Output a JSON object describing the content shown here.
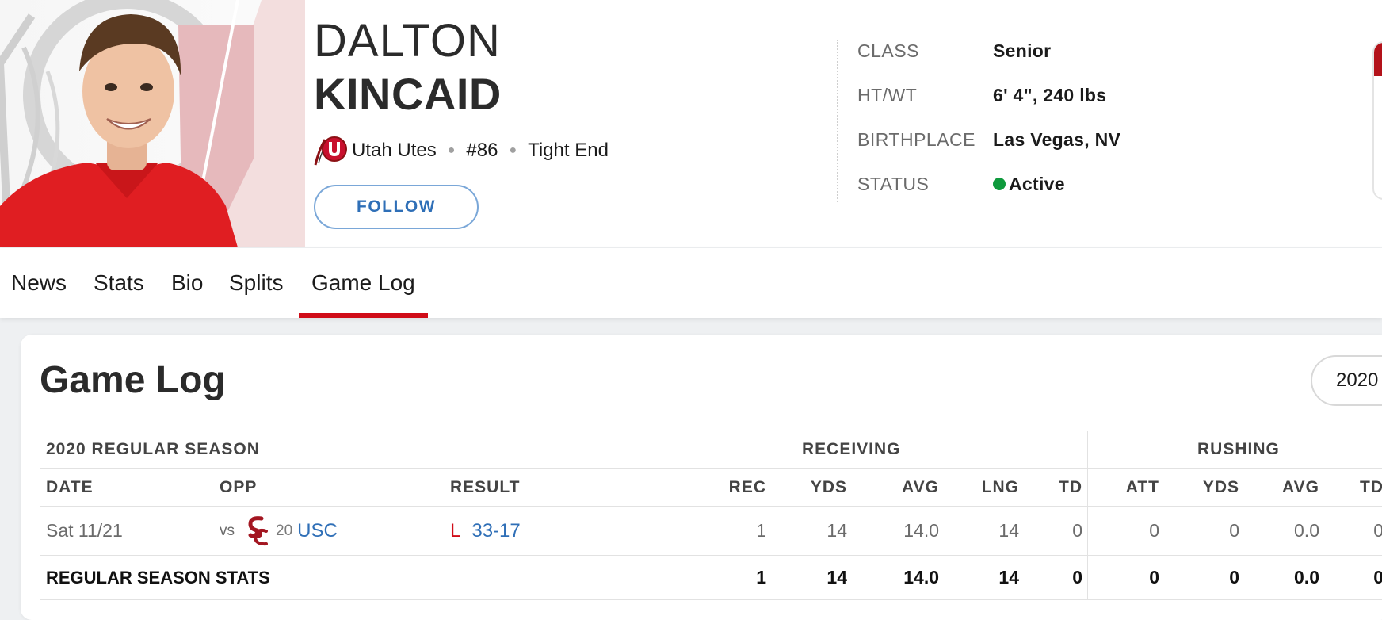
{
  "player": {
    "first_name": "DALTON",
    "last_name": "KINCAID",
    "team": "Utah Utes",
    "number": "#86",
    "position": "Tight End",
    "follow_label": "FOLLOW"
  },
  "bio": [
    {
      "label": "CLASS",
      "value": "Senior"
    },
    {
      "label": "HT/WT",
      "value": "6' 4\", 240 lbs"
    },
    {
      "label": "BIRTHPLACE",
      "value": "Las Vegas, NV"
    },
    {
      "label": "STATUS",
      "value": "Active",
      "indicator_color": "#0f9a3d"
    }
  ],
  "tabs": [
    {
      "label": "News",
      "active": false
    },
    {
      "label": "Stats",
      "active": false
    },
    {
      "label": "Bio",
      "active": false
    },
    {
      "label": "Splits",
      "active": false
    },
    {
      "label": "Game Log",
      "active": true
    }
  ],
  "game_log": {
    "title": "Game Log",
    "season_select": "2020",
    "section_label": "2020 REGULAR SEASON",
    "group_headers": {
      "receiving": "RECEIVING",
      "rushing": "RUSHING"
    },
    "columns": [
      "DATE",
      "OPP",
      "RESULT",
      "REC",
      "YDS",
      "AVG",
      "LNG",
      "TD",
      "ATT",
      "YDS",
      "AVG",
      "TD"
    ],
    "games": [
      {
        "date": "Sat 11/21",
        "vs": "vs",
        "opp_rank": "20",
        "opp": "USC",
        "result_letter": "L",
        "score": "33-17",
        "rec": "1",
        "rec_yds": "14",
        "rec_avg": "14.0",
        "rec_lng": "14",
        "rec_td": "0",
        "rush_att": "0",
        "rush_yds": "0",
        "rush_avg": "0.0",
        "rush_td": "0"
      }
    ],
    "totals": {
      "label": "REGULAR SEASON STATS",
      "rec": "1",
      "rec_yds": "14",
      "rec_avg": "14.0",
      "rec_lng": "14",
      "rec_td": "0",
      "rush_att": "0",
      "rush_yds": "0",
      "rush_avg": "0.0",
      "rush_td": "0"
    }
  },
  "colors": {
    "accent_red": "#d00c18",
    "link_blue": "#2f6fb7",
    "status_green": "#0f9a3d"
  }
}
